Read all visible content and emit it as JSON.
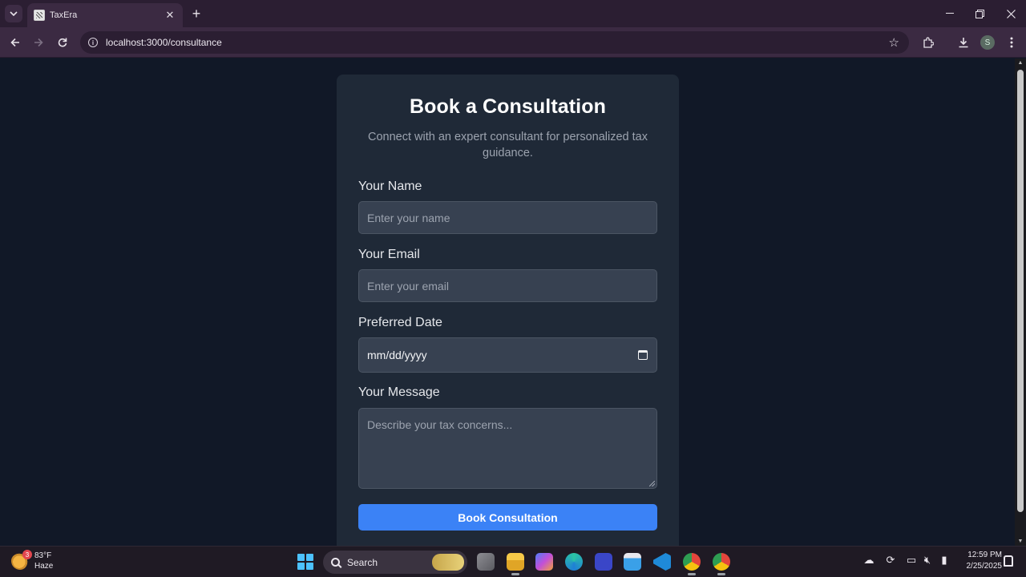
{
  "browser": {
    "tab_title": "TaxEra",
    "tab_close_icon": "close-icon",
    "new_tab_label": "+",
    "url": "localhost:3000/consultance",
    "profile_initial": "S"
  },
  "form": {
    "heading": "Book a Consultation",
    "subtitle": "Connect with an expert consultant for personalized tax guidance.",
    "name_label": "Your Name",
    "name_placeholder": "Enter your name",
    "email_label": "Your Email",
    "email_placeholder": "Enter your email",
    "date_label": "Preferred Date",
    "date_value": "mm/dd/yyyy",
    "message_label": "Your Message",
    "message_placeholder": "Describe your tax concerns...",
    "submit_label": "Book Consultation"
  },
  "taskbar": {
    "weather_temp": "83°F",
    "weather_desc": "Haze",
    "weather_badge": "3",
    "search_label": "Search",
    "time": "12:59 PM",
    "date": "2/25/2025"
  },
  "colors": {
    "page_bg": "#111827",
    "card_bg": "#1f2937",
    "input_bg": "#374151",
    "button_bg": "#3b82f6",
    "chrome_frame": "#2b1e32"
  }
}
